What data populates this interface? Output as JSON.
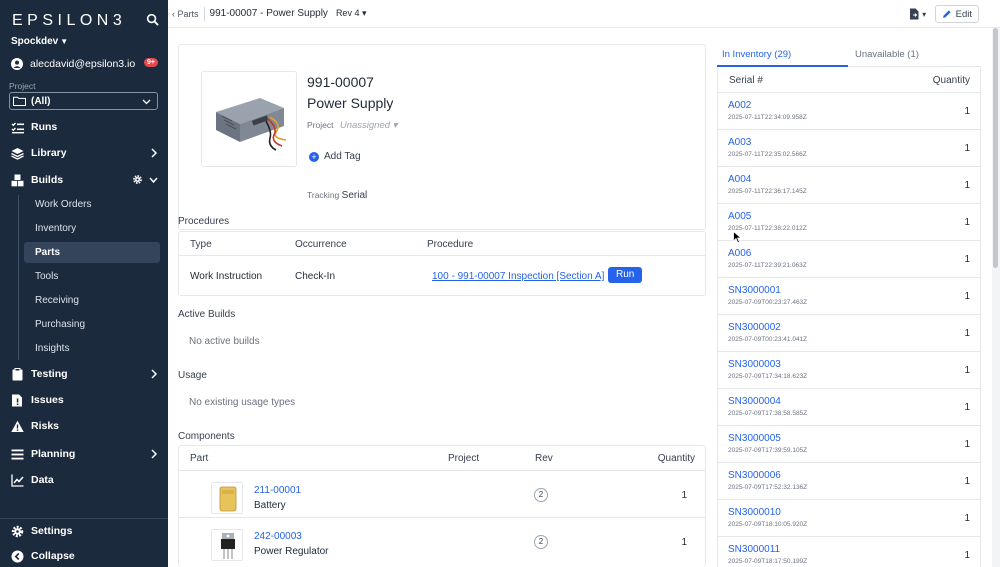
{
  "app": {
    "logo": "EPSILON3",
    "org": "Spockdev",
    "user_email": "alecdavid@epsilon3.io",
    "notif_badge": "9+"
  },
  "project": {
    "label": "Project",
    "value": "(All)"
  },
  "nav": {
    "runs": "Runs",
    "library": "Library",
    "builds": "Builds",
    "builds_sub": [
      "Work Orders",
      "Inventory",
      "Parts",
      "Tools",
      "Receiving",
      "Purchasing",
      "Insights"
    ],
    "testing": "Testing",
    "issues": "Issues",
    "risks": "Risks",
    "planning": "Planning",
    "data": "Data",
    "settings": "Settings",
    "collapse": "Collapse"
  },
  "breadcrumb": {
    "back": "Parts",
    "title": "991-00007 - Power Supply",
    "rev": "Rev 4"
  },
  "toolbar": {
    "edit": "Edit"
  },
  "part": {
    "number": "991-00007",
    "name": "Power Supply",
    "project_label": "Project",
    "project_value": "Unassigned",
    "add_tag": "Add Tag",
    "tracking_label": "Tracking",
    "tracking_value": "Serial"
  },
  "procedures": {
    "title": "Procedures",
    "headers": [
      "Type",
      "Occurrence",
      "Procedure"
    ],
    "row": {
      "type": "Work Instruction",
      "occurrence": "Check-In",
      "procedure": "100 - 991-00007 Inspection [Section A]",
      "run": "Run"
    }
  },
  "active_builds": {
    "title": "Active Builds",
    "empty": "No active builds"
  },
  "usage": {
    "title": "Usage",
    "empty": "No existing usage types"
  },
  "components": {
    "title": "Components",
    "headers": [
      "Part",
      "Project",
      "Rev",
      "Quantity"
    ],
    "rows": [
      {
        "id": "211-00001",
        "name": "Battery",
        "rev": "2",
        "qty": "1"
      },
      {
        "id": "242-00003",
        "name": "Power Regulator",
        "rev": "2",
        "qty": "1"
      }
    ]
  },
  "inventory": {
    "tab_active": "In Inventory (29)",
    "tab_inactive": "Unavailable (1)",
    "headers": [
      "Serial #",
      "Quantity"
    ],
    "rows": [
      {
        "serial": "A002",
        "date": "2025-07-11T22:34:09.958Z",
        "qty": "1"
      },
      {
        "serial": "A003",
        "date": "2025-07-11T22:35:02.566Z",
        "qty": "1"
      },
      {
        "serial": "A004",
        "date": "2025-07-11T22:36:17.145Z",
        "qty": "1"
      },
      {
        "serial": "A005",
        "date": "2025-07-11T22:38:22.012Z",
        "qty": "1"
      },
      {
        "serial": "A006",
        "date": "2025-07-11T22:39:21.063Z",
        "qty": "1"
      },
      {
        "serial": "SN3000001",
        "date": "2025-07-09T00:23:27.463Z",
        "qty": "1"
      },
      {
        "serial": "SN3000002",
        "date": "2025-07-09T00:23:41.041Z",
        "qty": "1"
      },
      {
        "serial": "SN3000003",
        "date": "2025-07-09T17:34:18.623Z",
        "qty": "1"
      },
      {
        "serial": "SN3000004",
        "date": "2025-07-09T17:38:58.585Z",
        "qty": "1"
      },
      {
        "serial": "SN3000005",
        "date": "2025-07-09T17:39:59.105Z",
        "qty": "1"
      },
      {
        "serial": "SN3000006",
        "date": "2025-07-09T17:52:32.136Z",
        "qty": "1"
      },
      {
        "serial": "SN3000010",
        "date": "2025-07-09T18:10:05.920Z",
        "qty": "1"
      },
      {
        "serial": "SN3000011",
        "date": "2025-07-09T18:17:50.199Z",
        "qty": "1"
      }
    ]
  },
  "colors": {
    "sidebar_bg": "#1c2a3d",
    "accent": "#2563eb",
    "badge": "#e5484d"
  }
}
